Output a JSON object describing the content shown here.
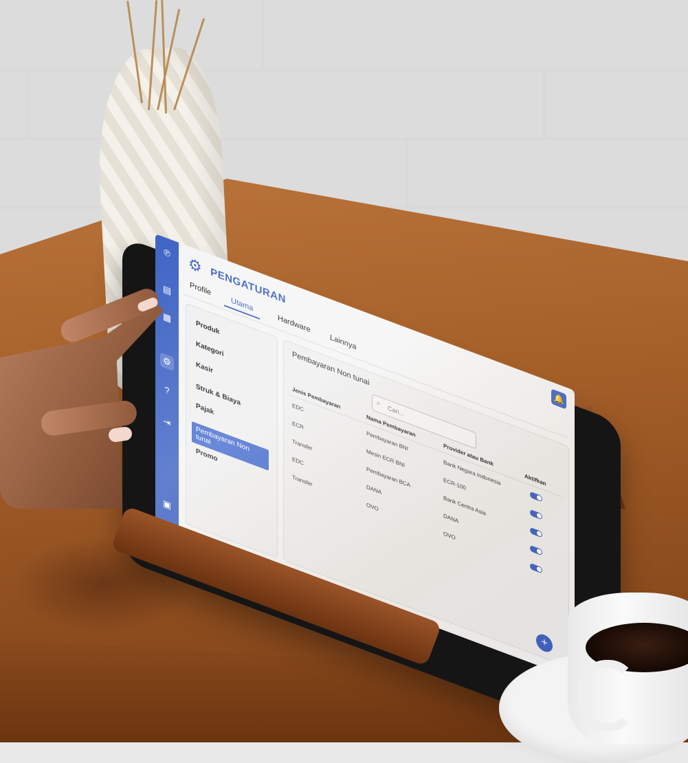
{
  "app": {
    "title": "PENGATURAN",
    "icon": "gear-icon",
    "accent_color": "#3f64c4"
  },
  "sidebar": {
    "icons": [
      "app-logo-icon",
      "cash-register-icon",
      "clipboard-icon",
      "gear-icon",
      "help-icon",
      "logout-icon",
      "calculator-icon"
    ]
  },
  "tabs": [
    {
      "label": "Profile",
      "active": false
    },
    {
      "label": "Utama",
      "active": true
    },
    {
      "label": "Hardware",
      "active": false
    },
    {
      "label": "Lainnya",
      "active": false
    }
  ],
  "menu": {
    "items": [
      {
        "label": "Produk",
        "active": false
      },
      {
        "label": "Kategori",
        "active": false
      },
      {
        "label": "Kasir",
        "active": false
      },
      {
        "label": "Struk & Biaya",
        "active": false
      },
      {
        "label": "Pajak",
        "active": false
      },
      {
        "label": "Pembayaran Non tunai",
        "active": true
      },
      {
        "label": "Promo",
        "active": false
      }
    ]
  },
  "content": {
    "section_title": "Pembayaran Non tunai",
    "search": {
      "placeholder": "Cari..."
    },
    "table": {
      "headers": [
        "Jenis Pembayaran",
        "Nama Pembayaran",
        "Provider atau Bank",
        "Aktifkan"
      ],
      "rows": [
        {
          "jenis": "EDC",
          "nama": "Pembayaran BNI",
          "provider": "Bank Negara Indonesia",
          "aktif": true
        },
        {
          "jenis": "ECR",
          "nama": "Mesin ECR BNI",
          "provider": "ECR-100",
          "aktif": true
        },
        {
          "jenis": "Transfer",
          "nama": "Pembayaran BCA",
          "provider": "Bank Centra Asia",
          "aktif": true
        },
        {
          "jenis": "EDC",
          "nama": "DANA",
          "provider": "DANA",
          "aktif": true
        },
        {
          "jenis": "Transfer",
          "nama": "OVO",
          "provider": "OVO",
          "aktif": true
        }
      ]
    }
  },
  "fab": {
    "label": "+"
  },
  "notification_icon": "bell-icon"
}
